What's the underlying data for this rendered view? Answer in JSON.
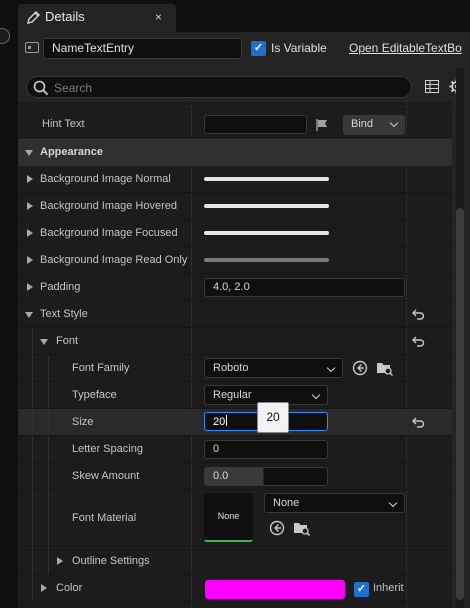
{
  "tab": {
    "title": "Details",
    "close": "×"
  },
  "name_input": {
    "value": "NameTextEntry"
  },
  "is_variable": {
    "label": "Is Variable",
    "checked": true
  },
  "open_link": "Open EditableTextBo",
  "search": {
    "placeholder": "Search"
  },
  "hint_text": {
    "label": "Hint Text",
    "bind_label": "Bind"
  },
  "appearance": {
    "label": "Appearance"
  },
  "bg_images": [
    {
      "label": "Background Image Normal"
    },
    {
      "label": "Background Image Hovered"
    },
    {
      "label": "Background Image Focused"
    },
    {
      "label": "Background Image Read Only"
    }
  ],
  "padding": {
    "label": "Padding",
    "value": "4.0, 2.0"
  },
  "text_style": {
    "label": "Text Style"
  },
  "font": {
    "label": "Font"
  },
  "font_family": {
    "label": "Font Family",
    "value": "Roboto"
  },
  "typeface": {
    "label": "Typeface",
    "value": "Regular"
  },
  "size": {
    "label": "Size",
    "value": "20",
    "tooltip": "20"
  },
  "letter_spacing": {
    "label": "Letter Spacing",
    "value": "0"
  },
  "skew_amount": {
    "label": "Skew Amount",
    "value": "0.0"
  },
  "font_material": {
    "label": "Font Material",
    "thumb": "None",
    "value": "None"
  },
  "outline_settings": {
    "label": "Outline Settings"
  },
  "color": {
    "label": "Color",
    "swatch": "#ff00ff",
    "inherit_label": "Inherit",
    "inherit_checked": true
  },
  "colors": {
    "accent": "#1e6fd0",
    "focus_border": "#2a8cff"
  }
}
